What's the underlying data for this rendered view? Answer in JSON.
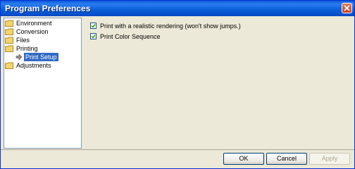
{
  "window": {
    "title": "Program Preferences",
    "close_icon": "close-icon"
  },
  "tree": {
    "items": [
      {
        "label": "Environment",
        "icon": "folder-icon"
      },
      {
        "label": "Conversion",
        "icon": "folder-icon"
      },
      {
        "label": "Files",
        "icon": "folder-icon"
      },
      {
        "label": "Printing",
        "icon": "folder-icon"
      },
      {
        "label": "Print Setup",
        "icon": "arrow-icon",
        "selected": true
      },
      {
        "label": "Adjustments",
        "icon": "folder-icon"
      }
    ]
  },
  "options": {
    "realistic_rendering": {
      "label": "Print with a realistic rendering (won't show jumps.)",
      "checked": true
    },
    "color_sequence": {
      "label": "Print Color Sequence",
      "checked": true
    }
  },
  "buttons": {
    "ok": "OK",
    "cancel": "Cancel",
    "apply": "Apply"
  },
  "colors": {
    "titlebar": "#0a5ed8",
    "selection": "#316ac5",
    "folder": "#f5d36b"
  }
}
